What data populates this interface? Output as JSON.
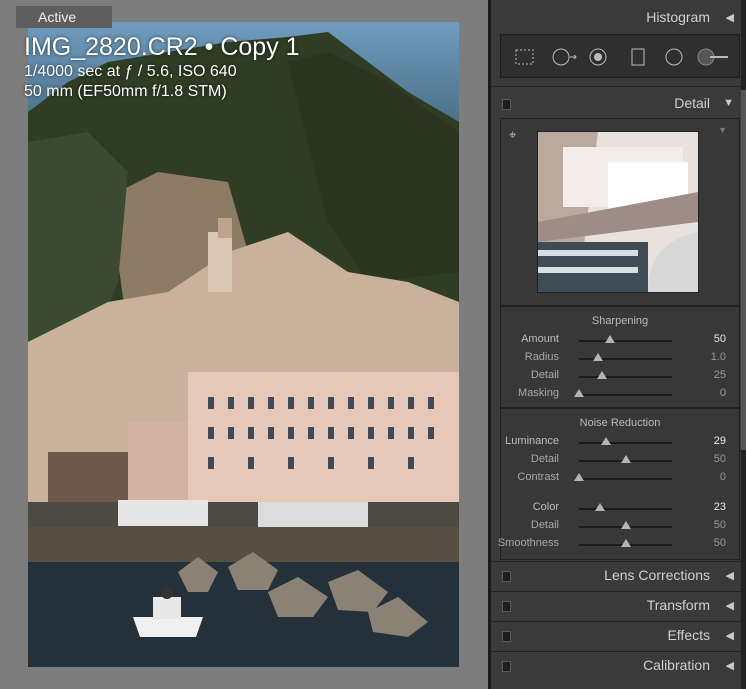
{
  "viewer": {
    "active_label": "Active",
    "filename": "IMG_2820.CR2 • Copy 1",
    "exposure": "1/4000 sec at ƒ / 5.6, ISO 640",
    "lens": "50 mm (EF50mm f/1.8 STM)"
  },
  "panels": {
    "histogram": "Histogram",
    "detail": "Detail",
    "lens_corrections": "Lens Corrections",
    "transform": "Transform",
    "effects": "Effects",
    "calibration": "Calibration"
  },
  "tools": [
    "crop-overlay-icon",
    "spot-removal-icon",
    "red-eye-icon",
    "graduated-filter-icon",
    "radial-filter-icon",
    "adjustment-brush-icon"
  ],
  "sharpening": {
    "title": "Sharpening",
    "rows": [
      {
        "label": "Amount",
        "value": "50",
        "pos": 0.33,
        "strong": true
      },
      {
        "label": "Radius",
        "value": "1.0",
        "pos": 0.2,
        "strong": false
      },
      {
        "label": "Detail",
        "value": "25",
        "pos": 0.25,
        "strong": false
      },
      {
        "label": "Masking",
        "value": "0",
        "pos": 0.0,
        "strong": false
      }
    ]
  },
  "noise": {
    "title": "Noise Reduction",
    "rows": [
      {
        "label": "Luminance",
        "value": "29",
        "pos": 0.29,
        "strong": true
      },
      {
        "label": "Detail",
        "value": "50",
        "pos": 0.5,
        "strong": false
      },
      {
        "label": "Contrast",
        "value": "0",
        "pos": 0.0,
        "strong": false
      },
      {
        "label": "Color",
        "value": "23",
        "pos": 0.23,
        "strong": true
      },
      {
        "label": "Detail",
        "value": "50",
        "pos": 0.5,
        "strong": false
      },
      {
        "label": "Smoothness",
        "value": "50",
        "pos": 0.5,
        "strong": false
      }
    ]
  }
}
